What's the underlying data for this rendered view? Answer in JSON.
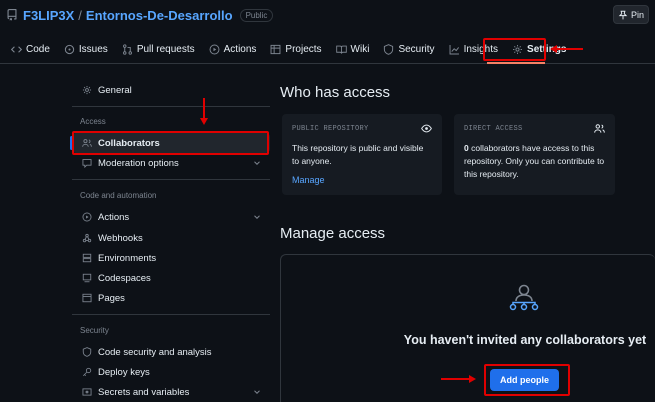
{
  "repo": {
    "owner": "F3LIP3X",
    "separator": "/",
    "name": "Entornos-De-Desarrollo",
    "visibility_badge": "Public",
    "pin_label": "Pin"
  },
  "tabs": [
    {
      "label": "Code",
      "icon": "code-icon"
    },
    {
      "label": "Issues",
      "icon": "issue-icon"
    },
    {
      "label": "Pull requests",
      "icon": "pull-request-icon"
    },
    {
      "label": "Actions",
      "icon": "play-icon"
    },
    {
      "label": "Projects",
      "icon": "table-icon"
    },
    {
      "label": "Wiki",
      "icon": "book-icon"
    },
    {
      "label": "Security",
      "icon": "shield-icon"
    },
    {
      "label": "Insights",
      "icon": "graph-icon"
    },
    {
      "label": "Settings",
      "icon": "gear-icon",
      "active": true
    }
  ],
  "sidebar": {
    "general": "General",
    "access_heading": "Access",
    "collaborators": "Collaborators",
    "moderation": "Moderation options",
    "code_heading": "Code and automation",
    "actions": "Actions",
    "webhooks": "Webhooks",
    "environments": "Environments",
    "codespaces": "Codespaces",
    "pages": "Pages",
    "security_heading": "Security",
    "code_security": "Code security and analysis",
    "deploy_keys": "Deploy keys",
    "secrets": "Secrets and variables"
  },
  "main": {
    "who_has_access_title": "Who has access",
    "public_card": {
      "title": "PUBLIC REPOSITORY",
      "body": "This repository is public and visible to anyone.",
      "link": "Manage"
    },
    "direct_card": {
      "title": "DIRECT ACCESS",
      "count": "0",
      "body": " collaborators have access to this repository. Only you can contribute to this repository."
    },
    "manage_access_title": "Manage access",
    "empty_title": "You haven't invited any collaborators yet",
    "add_people_label": "Add people"
  },
  "colors": {
    "background": "#0d1117",
    "accent": "#1f6feb",
    "link": "#58a6ff",
    "annotation": "#e00000"
  }
}
